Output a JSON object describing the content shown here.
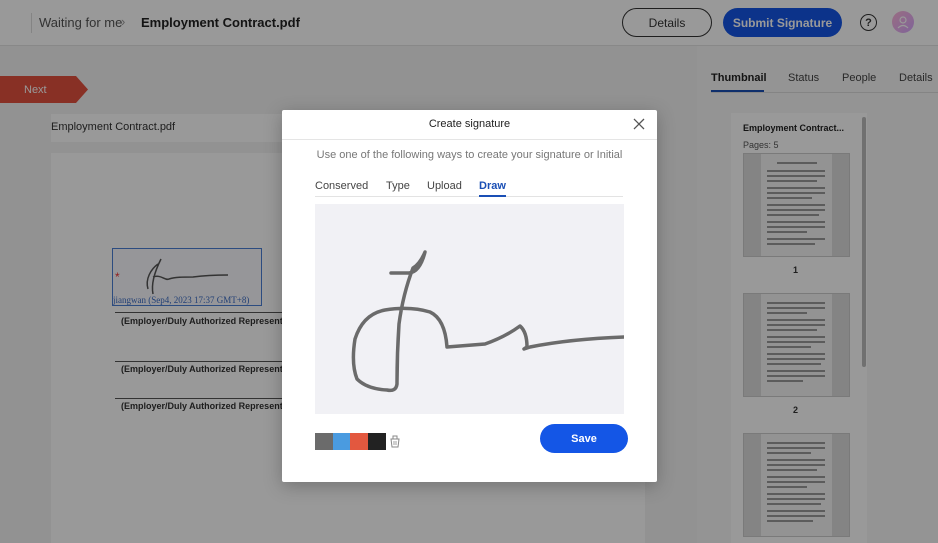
{
  "header": {
    "breadcrumb_parent": "Waiting for me",
    "breadcrumb_separator": "›",
    "document_title": "Employment Contract.pdf",
    "details_label": "Details",
    "submit_label": "Submit Signature",
    "help_icon": "question-circle-icon",
    "avatar_icon": "user-avatar-icon",
    "accent_color": "#1456e6"
  },
  "document": {
    "next_label": "Next",
    "file_name": "Employment Contract.pdf",
    "signature_stamp": "jiangwan (Sep4, 2023 17:37 GMT+8)",
    "required_marker": "*",
    "captions": [
      "(Employer/Duly Authorized Representat",
      "(Employer/Duly Authorized Representati",
      "(Employer/Duly Authorized Representati"
    ]
  },
  "right_panel": {
    "tabs": [
      "Thumbnail",
      "Status",
      "People",
      "Details"
    ],
    "active_tab": "Thumbnail",
    "thumb_title": "Employment Contract...",
    "pages_label": "Pages: 5",
    "page_numbers": [
      "1",
      "2"
    ]
  },
  "modal": {
    "title": "Create signature",
    "subtitle": "Use one of the following ways to create your signature or Initial",
    "tabs": [
      "Conserved",
      "Type",
      "Upload",
      "Draw"
    ],
    "active_tab": "Draw",
    "colors": [
      "#6b6b6b",
      "#4a9be0",
      "#e3583f",
      "#222222"
    ],
    "eraser_icon": "eraser-icon",
    "close_icon": "close-icon",
    "save_label": "Save"
  }
}
